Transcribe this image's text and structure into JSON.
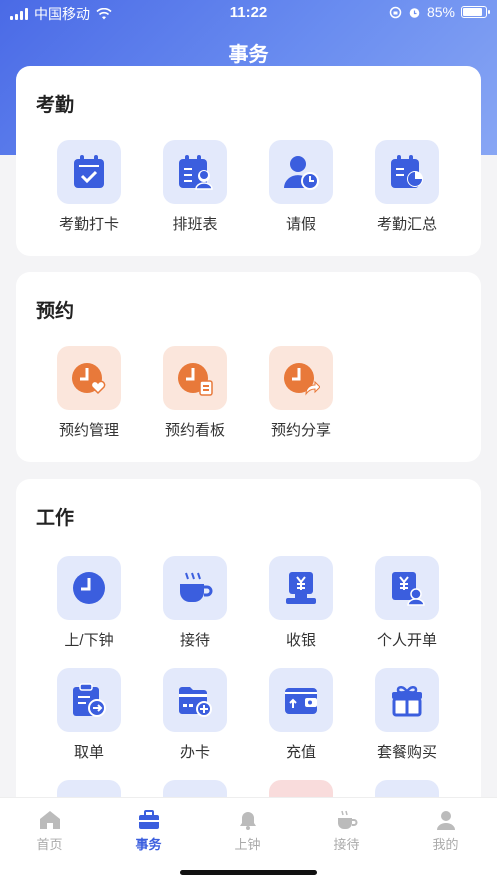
{
  "status": {
    "carrier": "中国移动",
    "time": "11:22",
    "battery": "85%"
  },
  "header": {
    "title": "事务"
  },
  "sections": [
    {
      "title": "考勤",
      "items": [
        {
          "label": "考勤打卡",
          "icon": "calendar-check-icon"
        },
        {
          "label": "排班表",
          "icon": "calendar-person-icon"
        },
        {
          "label": "请假",
          "icon": "person-clock-icon"
        },
        {
          "label": "考勤汇总",
          "icon": "calendar-chart-icon"
        }
      ]
    },
    {
      "title": "预约",
      "items": [
        {
          "label": "预约管理",
          "icon": "clock-heart-icon"
        },
        {
          "label": "预约看板",
          "icon": "clock-board-icon"
        },
        {
          "label": "预约分享",
          "icon": "clock-share-icon"
        }
      ]
    },
    {
      "title": "工作",
      "items": [
        {
          "label": "上/下钟",
          "icon": "clock-icon"
        },
        {
          "label": "接待",
          "icon": "teacup-icon"
        },
        {
          "label": "收银",
          "icon": "cashier-icon"
        },
        {
          "label": "个人开单",
          "icon": "person-order-icon"
        },
        {
          "label": "取单",
          "icon": "clipboard-arrow-icon"
        },
        {
          "label": "办卡",
          "icon": "card-add-icon"
        },
        {
          "label": "充值",
          "icon": "wallet-icon"
        },
        {
          "label": "套餐购买",
          "icon": "gift-icon"
        }
      ]
    }
  ],
  "tabs": [
    {
      "label": "首页",
      "icon": "home-icon",
      "active": false
    },
    {
      "label": "事务",
      "icon": "briefcase-icon",
      "active": true
    },
    {
      "label": "上钟",
      "icon": "bell-icon",
      "active": false
    },
    {
      "label": "接待",
      "icon": "teacup-icon",
      "active": false
    },
    {
      "label": "我的",
      "icon": "user-icon",
      "active": false
    }
  ],
  "colors": {
    "primary": "#3b5ede",
    "orange": "#e8793a",
    "tile_blue": "#e3e9fb",
    "tile_orange": "#fbe6dc"
  }
}
